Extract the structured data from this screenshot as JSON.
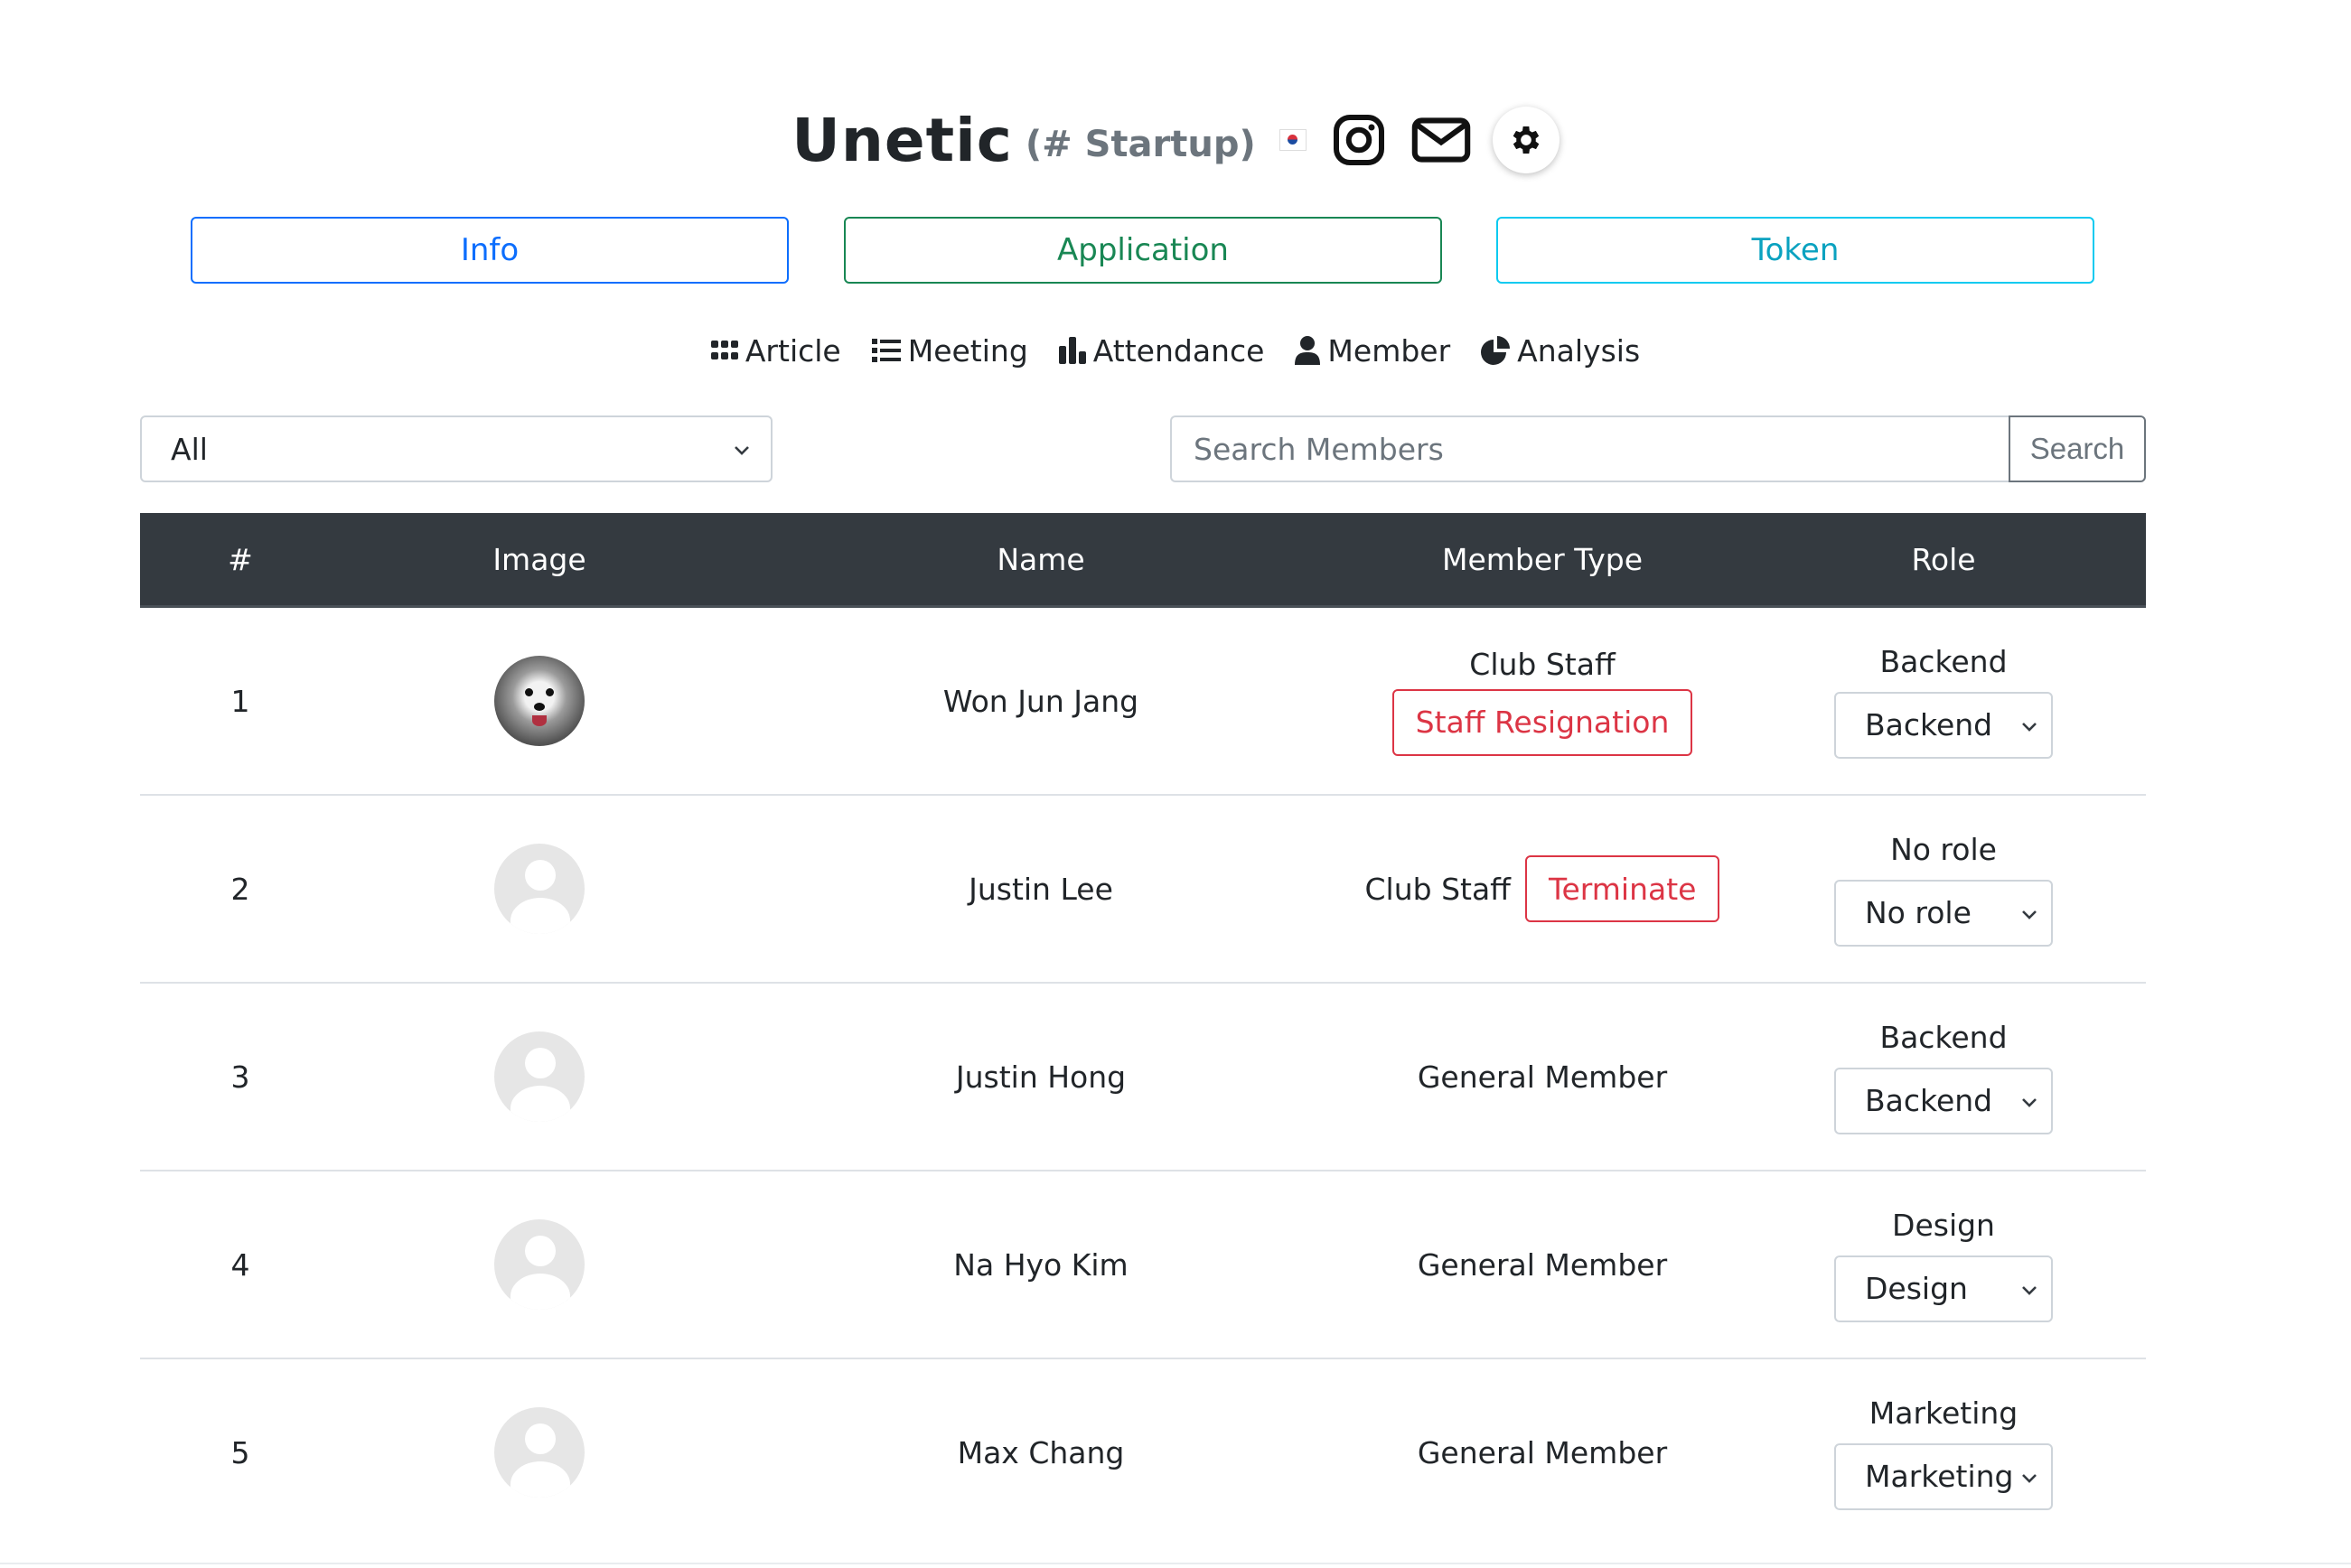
{
  "header": {
    "title": "Unetic",
    "category": "(# Startup)",
    "icons": [
      "korea-flag-icon",
      "instagram-icon",
      "mail-icon",
      "gear-icon"
    ]
  },
  "tabs": {
    "info": "Info",
    "application": "Application",
    "token": "Token"
  },
  "nav": {
    "article": "Article",
    "meeting": "Meeting",
    "attendance": "Attendance",
    "member": "Member",
    "analysis": "Analysis"
  },
  "filter": {
    "value": "All"
  },
  "search": {
    "placeholder": "Search Members",
    "button": "Search"
  },
  "table": {
    "headers": [
      "#",
      "Image",
      "Name",
      "Member Type",
      "Role"
    ],
    "rows": [
      {
        "num": "1",
        "name": "Won Jun Jang",
        "type": "Club Staff",
        "action": "Staff Resignation",
        "role": "Backend",
        "role_select": "Backend"
      },
      {
        "num": "2",
        "name": "Justin Lee",
        "type": "Club Staff",
        "action": "Terminate",
        "role": "No role",
        "role_select": "No role"
      },
      {
        "num": "3",
        "name": "Justin Hong",
        "type": "General Member",
        "role": "Backend",
        "role_select": "Backend"
      },
      {
        "num": "4",
        "name": "Na Hyo Kim",
        "type": "General Member",
        "role": "Design",
        "role_select": "Design"
      },
      {
        "num": "5",
        "name": "Max Chang",
        "type": "General Member",
        "role": "Marketing",
        "role_select": "Marketing"
      }
    ]
  },
  "colors": {
    "info": "#0d6efd",
    "application": "#198754",
    "token": "#0dcaf0",
    "danger": "#dc3545",
    "table_header": "#343a40"
  }
}
